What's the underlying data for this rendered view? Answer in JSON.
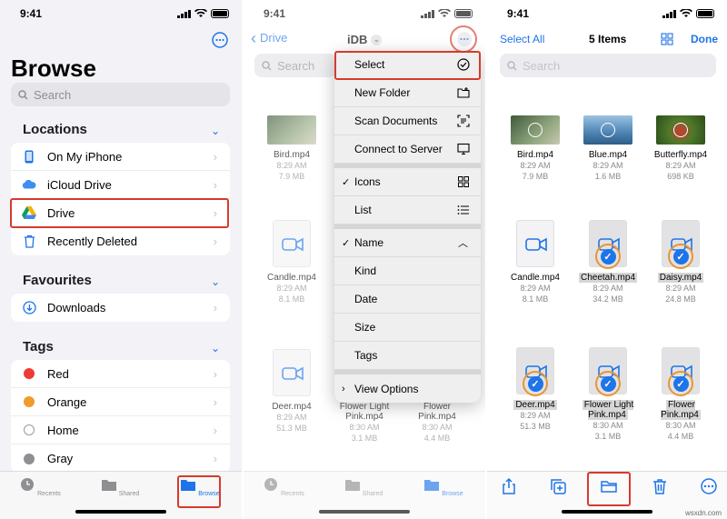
{
  "status": {
    "time": "9:41"
  },
  "panel1": {
    "title": "Browse",
    "search_placeholder": "Search",
    "locations_header": "Locations",
    "locations": [
      {
        "label": "On My iPhone",
        "icon": "phone-icon"
      },
      {
        "label": "iCloud Drive",
        "icon": "cloud-icon"
      },
      {
        "label": "Drive",
        "icon": "google-drive-icon"
      },
      {
        "label": "Recently Deleted",
        "icon": "trash-icon"
      }
    ],
    "favourites_header": "Favourites",
    "favourites": [
      {
        "label": "Downloads",
        "icon": "download-icon"
      }
    ],
    "tags_header": "Tags",
    "tags": [
      {
        "label": "Red",
        "color": "#ef3b35"
      },
      {
        "label": "Orange",
        "color": "#f29a2c"
      },
      {
        "label": "Home",
        "color": "#ffffff"
      },
      {
        "label": "Gray",
        "color": "#8e8e93"
      }
    ],
    "tabs": {
      "recents": "Recents",
      "shared": "Shared",
      "browse": "Browse"
    }
  },
  "panel2": {
    "back_label": "Drive",
    "folder_title": "iDB",
    "search_placeholder": "Search",
    "menu": {
      "select": "Select",
      "new_folder": "New Folder",
      "scan_documents": "Scan Documents",
      "connect_to_server": "Connect to Server",
      "icons": "Icons",
      "list": "List",
      "name": "Name",
      "kind": "Kind",
      "date": "Date",
      "size": "Size",
      "tags": "Tags",
      "view_options": "View Options"
    },
    "files": [
      {
        "name": "Bird.mp4",
        "time": "8:29 AM",
        "size": "7.9 MB"
      },
      {
        "name": "Candle.mp4",
        "time": "8:29 AM",
        "size": "8.1 MB"
      },
      {
        "name": "Deer.mp4",
        "time": "8:29 AM",
        "size": "51.3 MB"
      },
      {
        "name": "Flower Light Pink.mp4",
        "time": "8:30 AM",
        "size": "3.1 MB"
      },
      {
        "name": "Flower Pink.mp4",
        "time": "8:30 AM",
        "size": "4.4 MB"
      }
    ],
    "tabs": {
      "recents": "Recents",
      "shared": "Shared",
      "browse": "Browse"
    }
  },
  "panel3": {
    "select_all": "Select All",
    "count": "5 Items",
    "done": "Done",
    "search_placeholder": "Search",
    "files": [
      {
        "name": "Bird.mp4",
        "time": "8:29 AM",
        "size": "7.9 MB"
      },
      {
        "name": "Blue.mp4",
        "time": "8:29 AM",
        "size": "1.6 MB"
      },
      {
        "name": "Butterfly.mp4",
        "time": "8:29 AM",
        "size": "698 KB"
      },
      {
        "name": "Candle.mp4",
        "time": "8:29 AM",
        "size": "8.1 MB"
      },
      {
        "name": "Cheetah.mp4",
        "time": "8:29 AM",
        "size": "34.2 MB"
      },
      {
        "name": "Daisy.mp4",
        "time": "8:29 AM",
        "size": "24.8 MB"
      },
      {
        "name": "Deer.mp4",
        "time": "8:29 AM",
        "size": "51.3 MB"
      },
      {
        "name": "Flower Light Pink.mp4",
        "time": "8:30 AM",
        "size": "3.1 MB"
      },
      {
        "name": "Flower Pink.mp4",
        "time": "8:30 AM",
        "size": "4.4 MB"
      }
    ]
  },
  "watermark": "wsxdn.com",
  "colors": {
    "accent": "#1e74e8",
    "highlight": "#d63b2c",
    "selection_ring": "#e89531"
  }
}
